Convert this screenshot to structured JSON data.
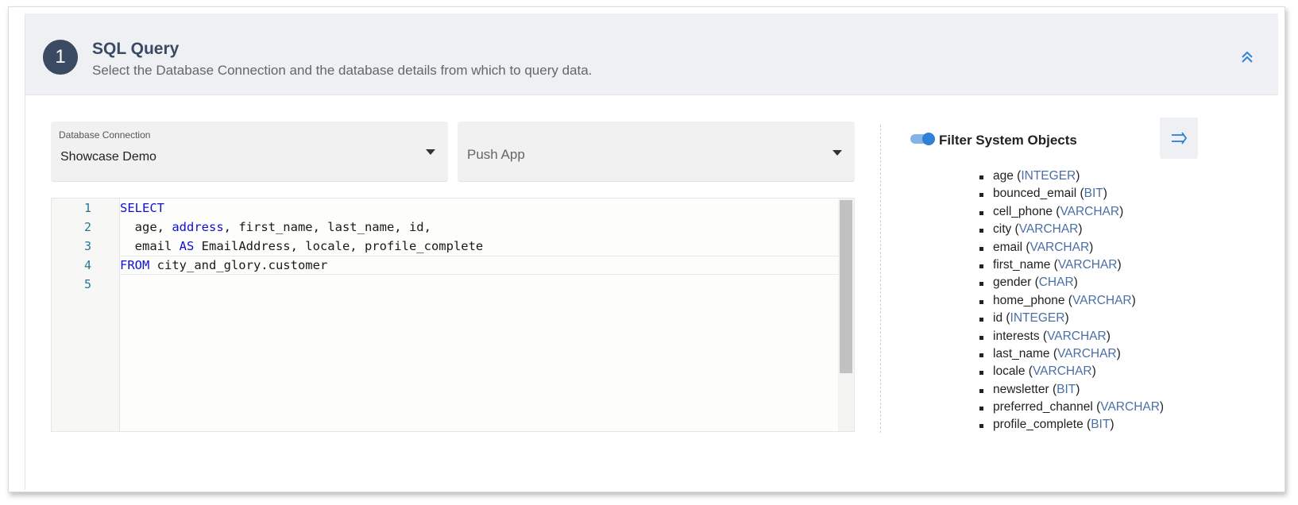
{
  "header": {
    "step_number": "1",
    "title": "SQL Query",
    "subtitle": "Select the Database Connection and the database details from which to query data.",
    "collapse_icon": "chevrons-up-icon"
  },
  "db_connection": {
    "label": "Database Connection",
    "value": "Showcase Demo"
  },
  "push_app": {
    "placeholder": "Push App"
  },
  "editor": {
    "line_numbers": [
      "1",
      "2",
      "3",
      "4",
      "5"
    ],
    "lines": [
      [
        {
          "t": "SELECT",
          "kw": true
        }
      ],
      [
        {
          "t": "  age, ",
          "kw": false
        },
        {
          "t": "address",
          "kw": true
        },
        {
          "t": ", first_name, last_name, id,",
          "kw": false
        }
      ],
      [
        {
          "t": "  email ",
          "kw": false
        },
        {
          "t": "AS",
          "kw": true
        },
        {
          "t": " EmailAddress, locale, profile_complete",
          "kw": false
        }
      ],
      [
        {
          "t": "FROM",
          "kw": true
        },
        {
          "t": " city_and_glory.customer",
          "kw": false
        }
      ],
      []
    ],
    "keyword_color": "#1010d0"
  },
  "schema_panel": {
    "filter_label": "Filter System Objects",
    "filter_enabled": true,
    "collapse_icon": "collapse-right-icon",
    "fields": [
      {
        "name": "age",
        "type": "INTEGER"
      },
      {
        "name": "bounced_email",
        "type": "BIT"
      },
      {
        "name": "cell_phone",
        "type": "VARCHAR"
      },
      {
        "name": "city",
        "type": "VARCHAR"
      },
      {
        "name": "email",
        "type": "VARCHAR"
      },
      {
        "name": "first_name",
        "type": "VARCHAR"
      },
      {
        "name": "gender",
        "type": "CHAR"
      },
      {
        "name": "home_phone",
        "type": "VARCHAR"
      },
      {
        "name": "id",
        "type": "INTEGER"
      },
      {
        "name": "interests",
        "type": "VARCHAR"
      },
      {
        "name": "last_name",
        "type": "VARCHAR"
      },
      {
        "name": "locale",
        "type": "VARCHAR"
      },
      {
        "name": "newsletter",
        "type": "BIT"
      },
      {
        "name": "preferred_channel",
        "type": "VARCHAR"
      },
      {
        "name": "profile_complete",
        "type": "BIT"
      }
    ]
  },
  "colors": {
    "accent": "#2f80d6",
    "header_bg": "#eef0f3",
    "badge_bg": "#3b4a63",
    "type_text": "#4a6fa5"
  }
}
